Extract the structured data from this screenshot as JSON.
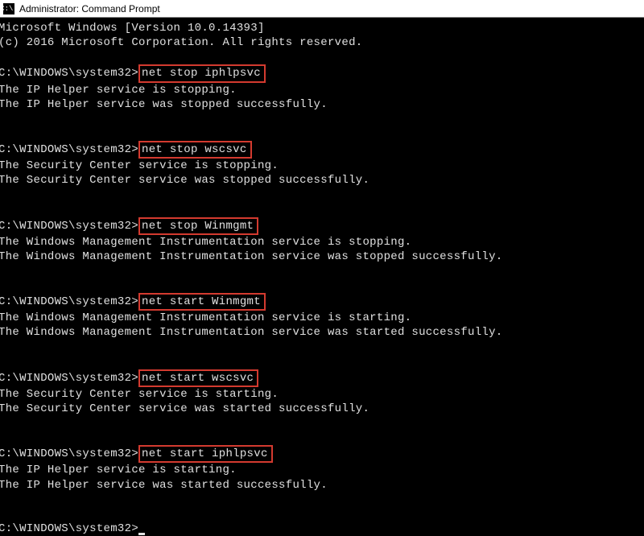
{
  "title": "Administrator: Command Prompt",
  "ticon": "C:\\.",
  "header1": "Microsoft Windows [Version 10.0.14393]",
  "header2": "(c) 2016 Microsoft Corporation. All rights reserved.",
  "prompt": "C:\\WINDOWS\\system32>",
  "cmds": {
    "c1": "net stop iphlpsvc",
    "c2": "net stop wscsvc",
    "c3": "net stop Winmgmt",
    "c4": "net start Winmgmt",
    "c5": "net start wscsvc",
    "c6": "net start iphlpsvc"
  },
  "out": {
    "o1a": "The IP Helper service is stopping.",
    "o1b": "The IP Helper service was stopped successfully.",
    "o2a": "The Security Center service is stopping.",
    "o2b": "The Security Center service was stopped successfully.",
    "o3a": "The Windows Management Instrumentation service is stopping.",
    "o3b": "The Windows Management Instrumentation service was stopped successfully.",
    "o4a": "The Windows Management Instrumentation service is starting.",
    "o4b": "The Windows Management Instrumentation service was started successfully.",
    "o5a": "The Security Center service is starting.",
    "o5b": "The Security Center service was started successfully.",
    "o6a": "The IP Helper service is starting.",
    "o6b": "The IP Helper service was started successfully."
  }
}
